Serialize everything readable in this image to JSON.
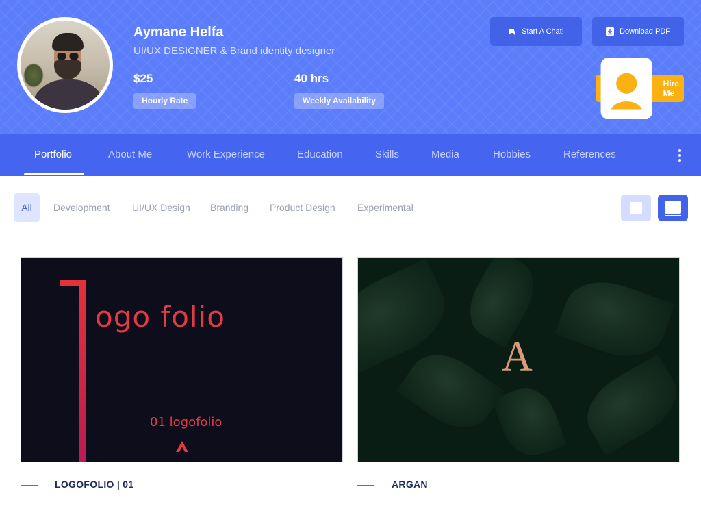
{
  "profile": {
    "name": "Aymane Helfa",
    "title": "UI/UX DESIGNER & Brand identity designer",
    "rate_value": "$25",
    "rate_label": "Hourly Rate",
    "availability_value": "40 hrs",
    "availability_label": "Weekly Availability"
  },
  "actions": {
    "chat": "Start A Chat!",
    "pdf": "Download PDF",
    "hire": "Hire Me"
  },
  "tabs": [
    {
      "label": "Portfolio",
      "active": true
    },
    {
      "label": "About Me"
    },
    {
      "label": "Work Experience"
    },
    {
      "label": "Education"
    },
    {
      "label": "Skills"
    },
    {
      "label": "Media"
    },
    {
      "label": "Hobbies"
    },
    {
      "label": "References"
    }
  ],
  "filters": [
    {
      "label": "All",
      "active": true
    },
    {
      "label": "Development"
    },
    {
      "label": "UI/UX Design"
    },
    {
      "label": "Branding"
    },
    {
      "label": "Product Design"
    },
    {
      "label": "Experimental"
    }
  ],
  "cards": [
    {
      "title": "LOGOFOLIO | 01",
      "image_text": "ogo folio",
      "image_subtext": "01 logofolio"
    },
    {
      "title": "ARGAN",
      "image_text": "A"
    }
  ],
  "colors": {
    "header_bg": "#5b7cfb",
    "tabbar_bg": "#4565f0",
    "button_bg": "#4262e8",
    "hire_bg": "#fbb112",
    "card_title": "#1e2b5c"
  },
  "icons": {
    "chat": "chat-bubble-icon",
    "pdf": "download-icon",
    "hire": "bookmark-icon",
    "menu": "more-vertical-icon",
    "grid_view": "grid-view-icon",
    "list_view": "monitor-view-icon"
  }
}
